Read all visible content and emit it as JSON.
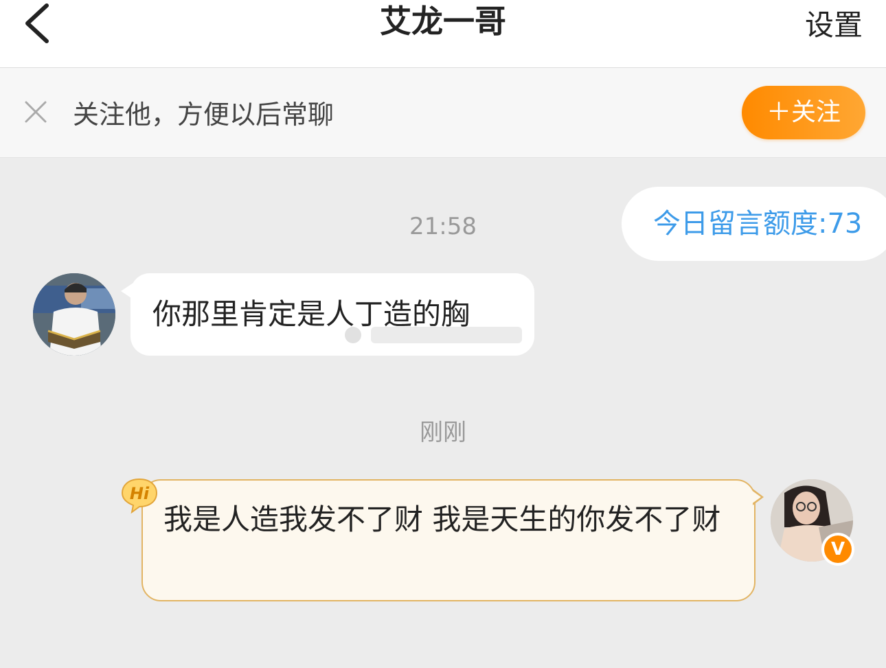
{
  "header": {
    "title": "艾龙一哥",
    "settings_label": "设置",
    "back_icon": "chevron-left-icon"
  },
  "follow_bar": {
    "prompt": "关注他，方便以后常聊",
    "button_label": "＋关注",
    "close_icon": "close-icon",
    "accent_color": "#ff9500"
  },
  "quota_notice": {
    "text": "今日留言额度:73",
    "color": "#3d9be9"
  },
  "messages": [
    {
      "timestamp": "21:58",
      "sender": "other",
      "text": "你那里肯定是人丁造的胸"
    },
    {
      "timestamp": "刚刚",
      "sender": "self",
      "text": "我是人造我发不了财 我是天生的你发不了财",
      "badge": "Hi"
    }
  ],
  "self_avatar": {
    "vip_badge": "V"
  },
  "colors": {
    "background": "#ececec",
    "self_bubble_bg": "#fdf8ee",
    "self_bubble_border": "#e2b463"
  }
}
